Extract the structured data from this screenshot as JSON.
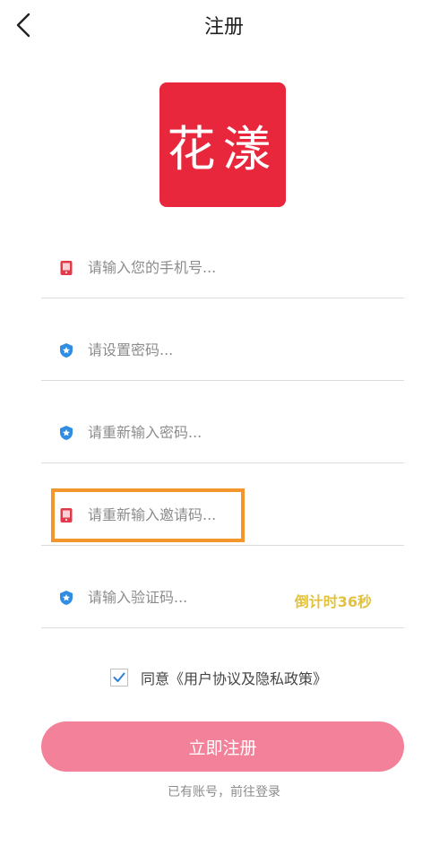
{
  "header": {
    "title": "注册",
    "back_icon": "back-arrow-icon"
  },
  "logo": {
    "text": "花漾",
    "color": "#e8273c"
  },
  "fields": [
    {
      "placeholder": "请输入您的手机号...",
      "icon": "phone-icon"
    },
    {
      "placeholder": "请设置密码...",
      "icon": "shield-icon"
    },
    {
      "placeholder": "请重新输入密码...",
      "icon": "shield-icon"
    },
    {
      "placeholder": "请重新输入邀请码...",
      "icon": "phone-icon"
    },
    {
      "placeholder": "请输入验证码...",
      "icon": "shield-icon",
      "countdown": "倒计时36秒"
    }
  ],
  "agreement": {
    "checked": true,
    "text": "同意《用户协议及隐私政策》"
  },
  "submit": {
    "label": "立即注册",
    "color": "#f38199"
  },
  "login_link": "已有账号，前往登录",
  "colors": {
    "countdown": "#e2c23c",
    "highlight_box": "#f4962c",
    "shield": "#2f8de4",
    "phone": "#e23a4a"
  }
}
